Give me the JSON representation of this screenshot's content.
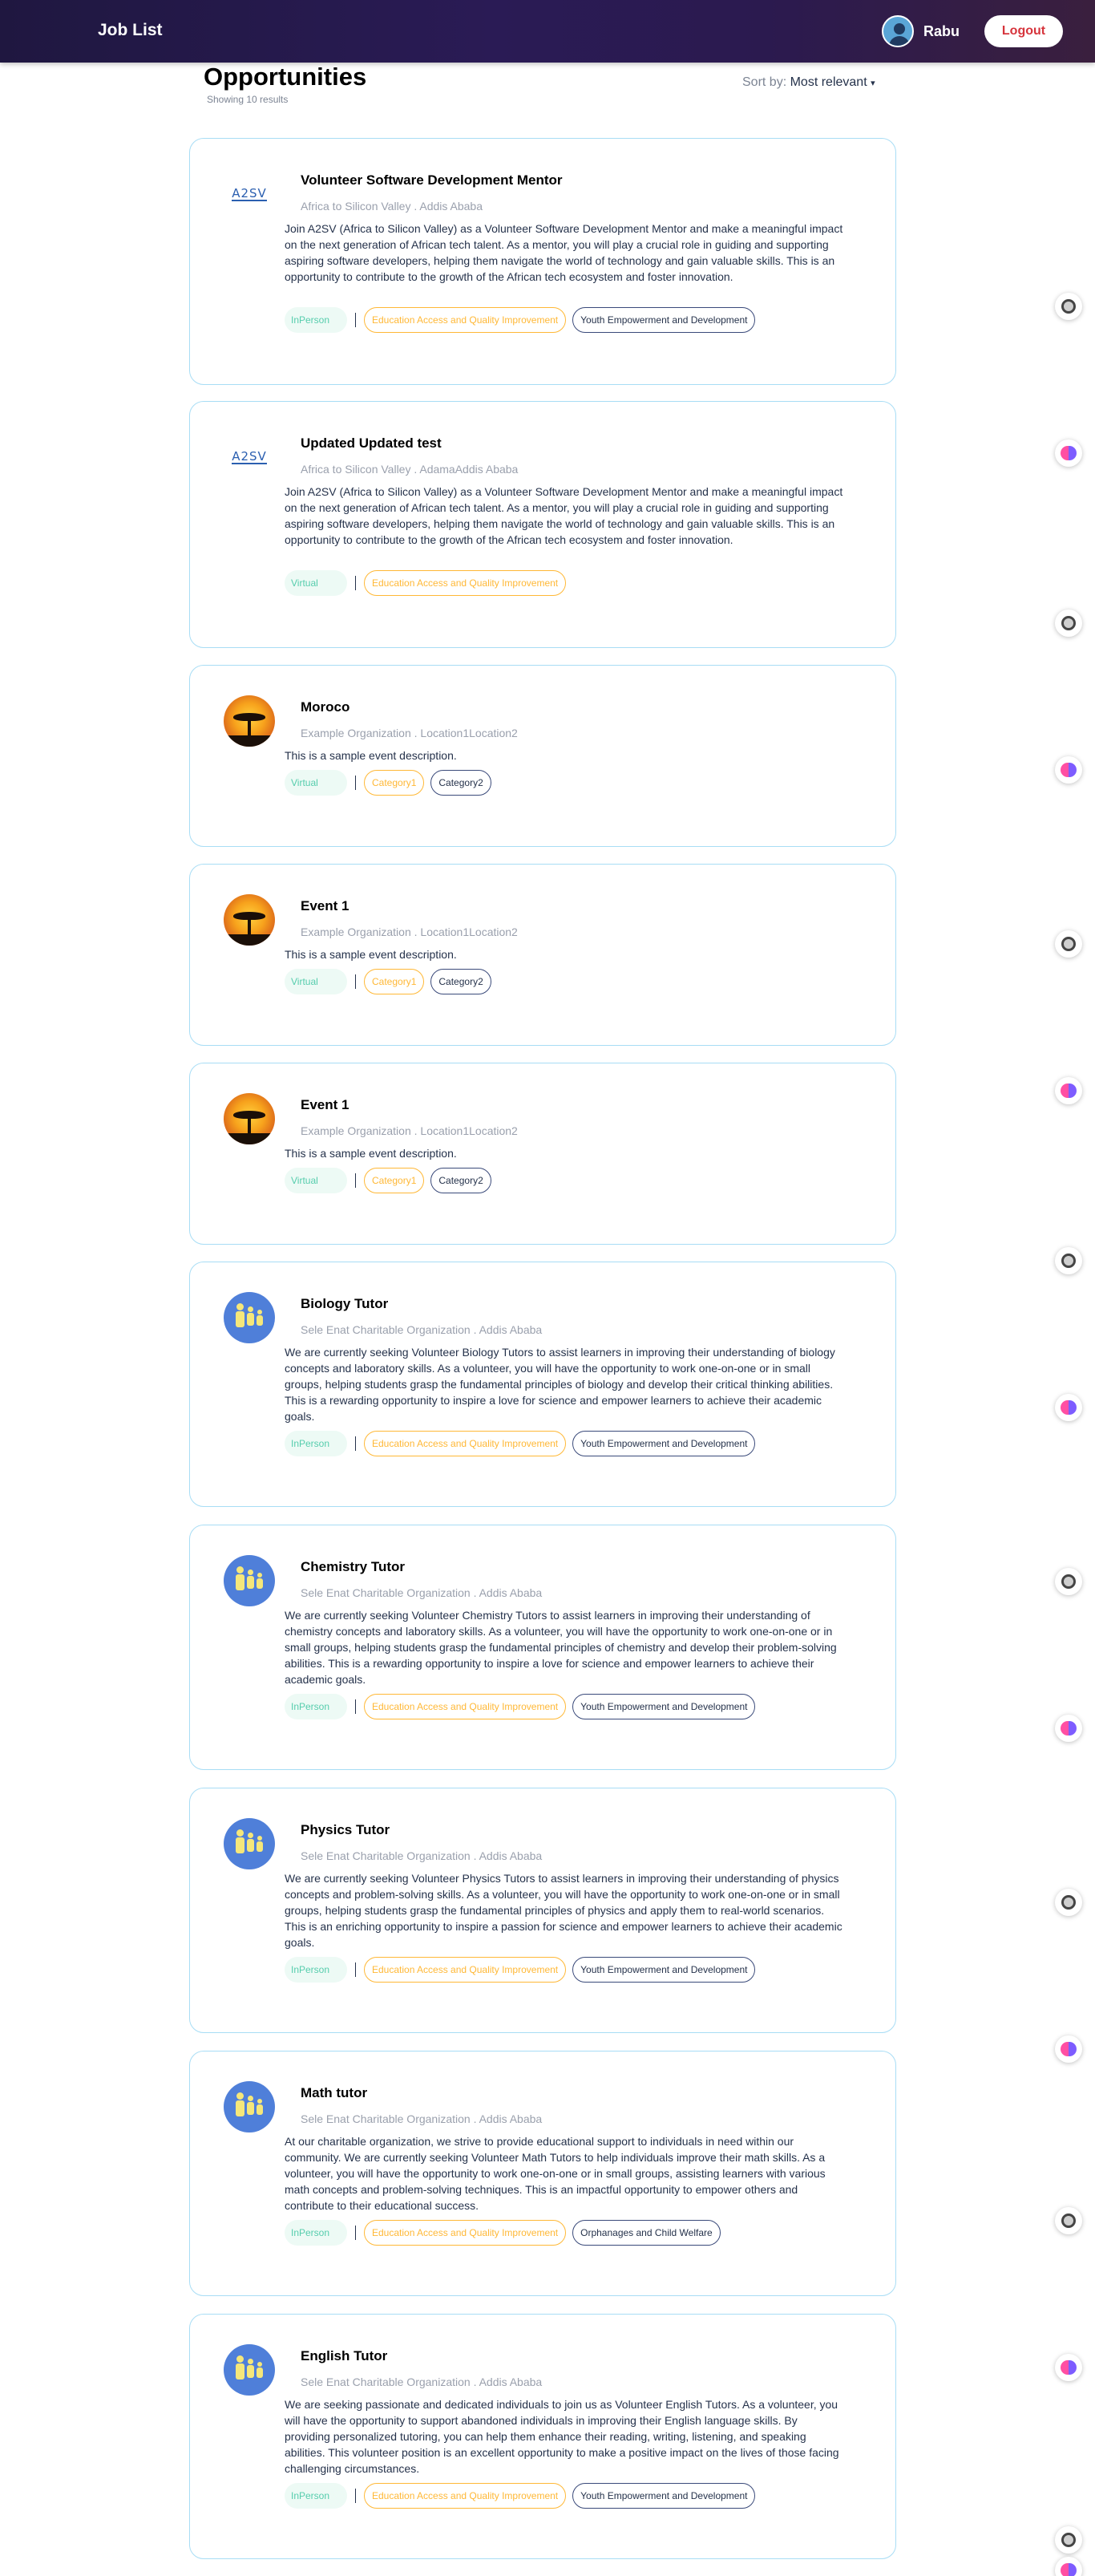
{
  "header": {
    "title": "Job List",
    "user_name": "Rabu",
    "logout_label": "Logout"
  },
  "page": {
    "title": "Opportunities",
    "results": "Showing 10 results",
    "sort_label": "Sort by:",
    "sort_value": "Most relevant"
  },
  "jobs": [
    {
      "title": "Volunteer Software Development Mentor",
      "meta": "Africa to Silicon Valley . Addis Ababa",
      "logo": "a2sv-logo",
      "logo_text": "A2SV",
      "desc": "Join A2SV (Africa to Silicon Valley) as a Volunteer Software Development Mentor and make a meaningful impact on the next generation of African tech talent. As a mentor, you will play a crucial role in guiding and supporting aspiring software developers, helping them navigate the world of technology and gain valuable skills. This is an opportunity to contribute to the growth of the African tech ecosystem and foster innovation.",
      "type": "InPerson",
      "tags": [
        "Education Access and Quality Improvement",
        "Youth Empowerment and Development"
      ]
    },
    {
      "title": "Updated Updated test",
      "meta": "Africa to Silicon Valley . AdamaAddis Ababa",
      "logo": "a2sv-logo",
      "logo_text": "A2SV",
      "desc": "Join A2SV (Africa to Silicon Valley) as a Volunteer Software Development Mentor and make a meaningful impact on the next generation of African tech talent. As a mentor, you will play a crucial role in guiding and supporting aspiring software developers, helping them navigate the world of technology and gain valuable skills. This is an opportunity to contribute to the growth of the African tech ecosystem and foster innovation.",
      "type": "Virtual",
      "tags": [
        "Education Access and Quality Improvement"
      ]
    },
    {
      "title": "Moroco",
      "meta": "Example Organization . Location1Location2",
      "logo": "sunset-tree-logo",
      "desc": "This is a sample event description.",
      "type": "Virtual",
      "tags": [
        "Category1",
        "Category2"
      ]
    },
    {
      "title": "Event 1",
      "meta": "Example Organization . Location1Location2",
      "logo": "sunset-tree-logo",
      "desc": "This is a sample event description.",
      "type": "Virtual",
      "tags": [
        "Category1",
        "Category2"
      ]
    },
    {
      "title": "Event 1",
      "meta": "Example Organization . Location1Location2",
      "logo": "sunset-tree-logo",
      "desc": "This is a sample event description.",
      "type": "Virtual",
      "tags": [
        "Category1",
        "Category2"
      ]
    },
    {
      "title": "Biology Tutor",
      "meta": "Sele Enat Charitable Organization . Addis Ababa",
      "logo": "sele-enat-logo",
      "desc": "We are currently seeking Volunteer Biology Tutors to assist learners in improving their understanding of biology concepts and laboratory skills. As a volunteer, you will have the opportunity to work one-on-one or in small groups, helping students grasp the fundamental principles of biology and develop their critical thinking abilities. This is a rewarding opportunity to inspire a love for science and empower learners to achieve their academic goals.",
      "type": "InPerson",
      "tags": [
        "Education Access and Quality Improvement",
        "Youth Empowerment and Development"
      ]
    },
    {
      "title": "Chemistry Tutor",
      "meta": "Sele Enat Charitable Organization . Addis Ababa",
      "logo": "sele-enat-logo",
      "desc": "We are currently seeking Volunteer Chemistry Tutors to assist learners in improving their understanding of chemistry concepts and laboratory skills. As a volunteer, you will have the opportunity to work one-on-one or in small groups, helping students grasp the fundamental principles of chemistry and develop their problem-solving abilities. This is a rewarding opportunity to inspire a love for science and empower learners to achieve their academic goals.",
      "type": "InPerson",
      "tags": [
        "Education Access and Quality Improvement",
        "Youth Empowerment and Development"
      ]
    },
    {
      "title": "Physics Tutor",
      "meta": "Sele Enat Charitable Organization . Addis Ababa",
      "logo": "sele-enat-logo",
      "desc": "We are currently seeking Volunteer Physics Tutors to assist learners in improving their understanding of physics concepts and problem-solving skills. As a volunteer, you will have the opportunity to work one-on-one or in small groups, helping students grasp the fundamental principles of physics and apply them to real-world scenarios. This is an enriching opportunity to inspire a passion for science and empower learners to achieve their academic goals.",
      "type": "InPerson",
      "tags": [
        "Education Access and Quality Improvement",
        "Youth Empowerment and Development"
      ]
    },
    {
      "title": "Math tutor",
      "meta": "Sele Enat Charitable Organization . Addis Ababa",
      "logo": "sele-enat-logo",
      "desc": "At our charitable organization, we strive to provide educational support to individuals in need within our community. We are currently seeking Volunteer Math Tutors to help individuals improve their math skills. As a volunteer, you will have the opportunity to work one-on-one or in small groups, assisting learners with various math concepts and problem-solving techniques. This is an impactful opportunity to empower others and contribute to their educational success.",
      "type": "InPerson",
      "tags": [
        "Education Access and Quality Improvement",
        "Orphanages and Child Welfare"
      ]
    },
    {
      "title": "English Tutor",
      "meta": "Sele Enat Charitable Organization . Addis Ababa",
      "logo": "sele-enat-logo",
      "desc": "We are seeking passionate and dedicated individuals to join us as Volunteer English Tutors. As a volunteer, you will have the opportunity to support abandoned individuals in improving their English language skills. By providing personalized tutoring, you can help them enhance their reading, writing, listening, and speaking abilities. This volunteer position is an excellent opportunity to make a positive impact on the lives of those facing challenging circumstances.",
      "type": "InPerson",
      "tags": [
        "Education Access and Quality Improvement",
        "Youth Empowerment and Development"
      ]
    }
  ],
  "side_icons": [
    "record-icon",
    "brain-icon",
    "record-icon",
    "brain-icon",
    "record-icon",
    "brain-icon",
    "record-icon",
    "brain-icon",
    "record-icon",
    "brain-icon",
    "record-icon",
    "brain-icon",
    "record-icon",
    "brain-icon",
    "record-icon",
    "brain-icon"
  ],
  "colors": {
    "nav_bg": "#2a1b55",
    "card_border": "#a8ddf5",
    "type_green": "#56CDAD",
    "tag_orange": "#FFB836",
    "logout_red": "#d6343c"
  }
}
